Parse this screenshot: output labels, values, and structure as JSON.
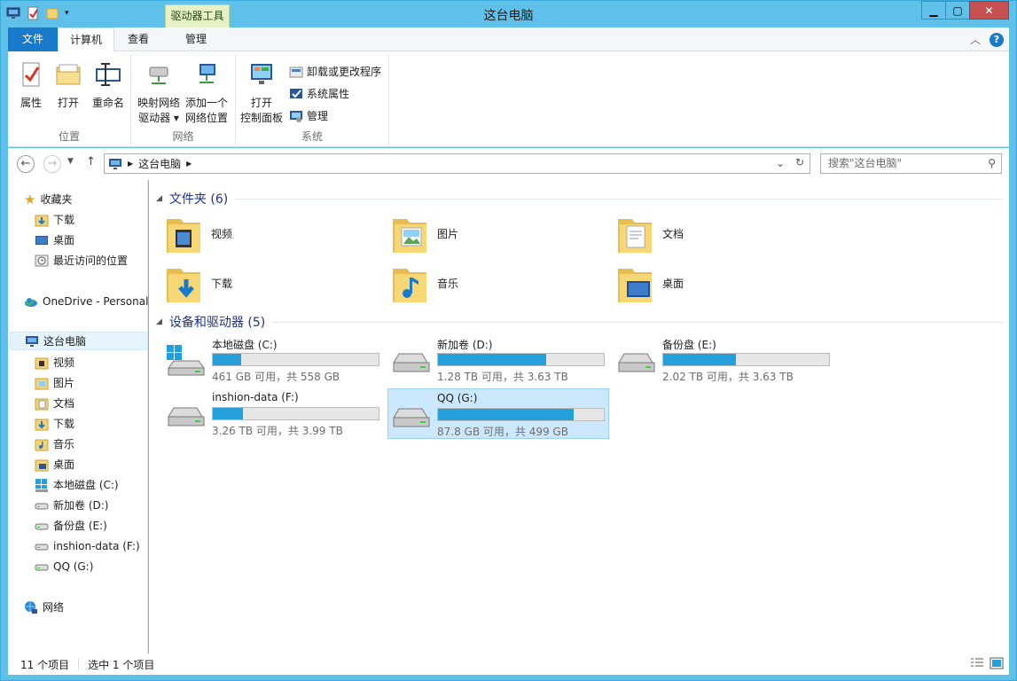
{
  "window": {
    "title": "这台电脑",
    "context_tab": "驱动器工具"
  },
  "tabs": [
    {
      "label": "文件"
    },
    {
      "label": "计算机"
    },
    {
      "label": "查看"
    },
    {
      "label": "管理"
    }
  ],
  "ribbon": {
    "location": {
      "label": "位置",
      "properties": "属性",
      "open": "打开",
      "rename": "重命名"
    },
    "network": {
      "label": "网络",
      "map_drive_l1": "映射网络",
      "map_drive_l2": "驱动器",
      "add_location_l1": "添加一个",
      "add_location_l2": "网络位置"
    },
    "system": {
      "label": "系统",
      "open_cp_l1": "打开",
      "open_cp_l2": "控制面板",
      "uninstall": "卸载或更改程序",
      "sys_props": "系统属性",
      "manage": "管理"
    }
  },
  "address": {
    "path": "这台电脑",
    "search_placeholder": "搜索\"这台电脑\""
  },
  "sidebar": {
    "favorites": "收藏夹",
    "fav_items": [
      {
        "label": "下载"
      },
      {
        "label": "桌面"
      },
      {
        "label": "最近访问的位置"
      }
    ],
    "onedrive": "OneDrive - Personal",
    "this_pc": "这台电脑",
    "pc_items": [
      {
        "label": "视频"
      },
      {
        "label": "图片"
      },
      {
        "label": "文档"
      },
      {
        "label": "下载"
      },
      {
        "label": "音乐"
      },
      {
        "label": "桌面"
      },
      {
        "label": "本地磁盘 (C:)"
      },
      {
        "label": "新加卷 (D:)"
      },
      {
        "label": "备份盘 (E:)"
      },
      {
        "label": "inshion-data (F:)"
      },
      {
        "label": "QQ (G:)"
      }
    ],
    "network": "网络"
  },
  "content": {
    "folders_header": "文件夹 (6)",
    "folders": [
      {
        "name": "视频",
        "icon": "video-folder-icon"
      },
      {
        "name": "图片",
        "icon": "pictures-folder-icon"
      },
      {
        "name": "文档",
        "icon": "documents-folder-icon"
      },
      {
        "name": "下载",
        "icon": "downloads-folder-icon"
      },
      {
        "name": "音乐",
        "icon": "music-folder-icon"
      },
      {
        "name": "桌面",
        "icon": "desktop-folder-icon"
      }
    ],
    "drives_header": "设备和驱动器 (5)",
    "drives": [
      {
        "name": "本地磁盘 (C:)",
        "size": "461 GB 可用，共 558 GB",
        "used_fraction": 0.17,
        "icon": "windows-drive-icon"
      },
      {
        "name": "新加卷 (D:)",
        "size": "1.28 TB 可用，共 3.63 TB",
        "used_fraction": 0.65,
        "icon": "hdd-icon"
      },
      {
        "name": "备份盘 (E:)",
        "size": "2.02 TB 可用，共 3.63 TB",
        "used_fraction": 0.44,
        "icon": "hdd-icon"
      },
      {
        "name": "inshion-data (F:)",
        "size": "3.26 TB 可用，共 3.99 TB",
        "used_fraction": 0.18,
        "icon": "hdd-icon"
      },
      {
        "name": "QQ (G:)",
        "size": "87.8 GB 可用，共 499 GB",
        "used_fraction": 0.82,
        "icon": "hdd-icon",
        "selected": true
      }
    ]
  },
  "status": {
    "count": "11 个项目",
    "selected": "选中 1 个项目"
  },
  "colors": {
    "title_bar": "#5fc1ea",
    "file_tab": "#1979ca",
    "drive_bar": "#26a0da",
    "selection": "#cce8ff"
  }
}
